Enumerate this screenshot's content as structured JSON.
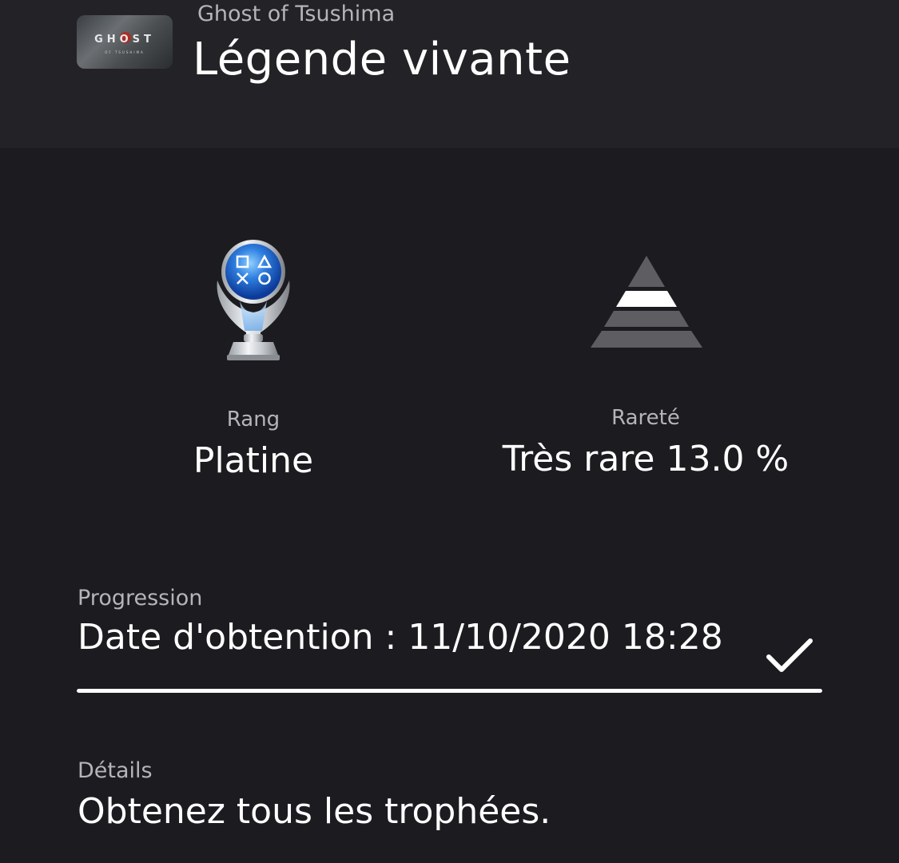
{
  "header": {
    "game_name": "Ghost of Tsushima",
    "trophy_title": "Légende vivante",
    "game_thumbnail": {
      "logo_text": "GHOST",
      "logo_subtext": "OF TSUSHIMA"
    }
  },
  "stats": {
    "rank_label": "Rang",
    "rank_value": "Platine",
    "rarity_label": "Rareté",
    "rarity_value": "Très rare 13.0 %"
  },
  "progress": {
    "label": "Progression",
    "value": "Date d'obtention : 11/10/2020  18:28",
    "percent": 100
  },
  "details": {
    "label": "Détails",
    "value": "Obtenez tous les trophées."
  },
  "icons": {
    "trophy": "platinum-trophy-icon",
    "rarity": "rarity-pyramid-icon",
    "check": "checkmark-icon"
  },
  "colors": {
    "background": "#1c1c20",
    "header_background": "#232327",
    "secondary_text": "#b5b5b9",
    "primary_text": "#ffffff",
    "rarity_highlight": "#ffffff",
    "rarity_inactive": "#5e5e62"
  }
}
